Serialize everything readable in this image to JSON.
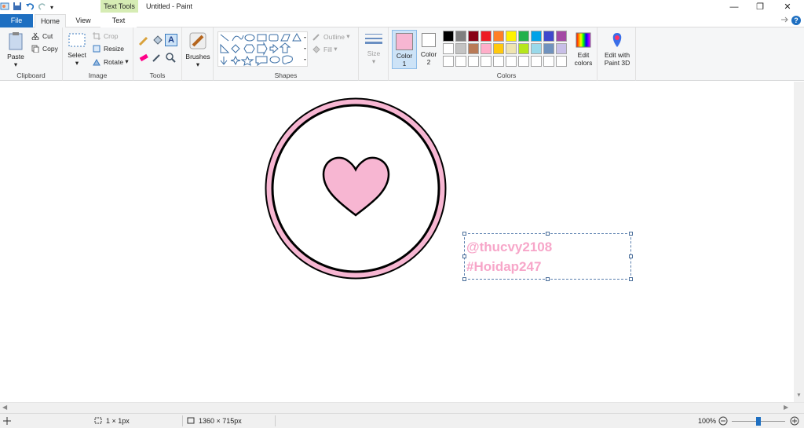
{
  "window": {
    "title": "Untitled - Paint",
    "contextual_tab": "Text Tools",
    "controls": {
      "minimize": "—",
      "restore": "❐",
      "close": "✕"
    }
  },
  "tabs": {
    "file": "File",
    "home": "Home",
    "view": "View",
    "text": "Text"
  },
  "ribbon": {
    "clipboard": {
      "label": "Clipboard",
      "paste": "Paste",
      "cut": "Cut",
      "copy": "Copy"
    },
    "image": {
      "label": "Image",
      "select": "Select",
      "crop": "Crop",
      "resize": "Resize",
      "rotate": "Rotate"
    },
    "tools": {
      "label": "Tools"
    },
    "brushes": {
      "label": "Brushes"
    },
    "shapes": {
      "label": "Shapes",
      "outline": "Outline",
      "fill": "Fill"
    },
    "size": {
      "label": "Size"
    },
    "color1": {
      "label": "Color",
      "num": "1",
      "value": "#f7b6d2"
    },
    "color2": {
      "label": "Color",
      "num": "2",
      "value": "#ffffff"
    },
    "colors": {
      "label": "Colors"
    },
    "edit_colors": {
      "line1": "Edit",
      "line2": "colors"
    },
    "paint3d": {
      "line1": "Edit with",
      "line2": "Paint 3D"
    }
  },
  "palette_row1": [
    "#000000",
    "#7f7f7f",
    "#880015",
    "#ed1c24",
    "#ff7f27",
    "#fff200",
    "#22b14c",
    "#00a2e8",
    "#3f48cc",
    "#a349a4"
  ],
  "palette_row2": [
    "#ffffff",
    "#c3c3c3",
    "#b97a57",
    "#ffaec9",
    "#ffc90e",
    "#efe4b0",
    "#b5e61d",
    "#99d9ea",
    "#7092be",
    "#c8bfe7"
  ],
  "canvas": {
    "text_line1": "@thucvy2108",
    "text_line2": "#Hoidap247",
    "text_color": "#f7a6c9",
    "pink": "#f7b6d2"
  },
  "status": {
    "selection": "1 × 1px",
    "image_size": "1360 × 715px",
    "zoom": "100%"
  }
}
